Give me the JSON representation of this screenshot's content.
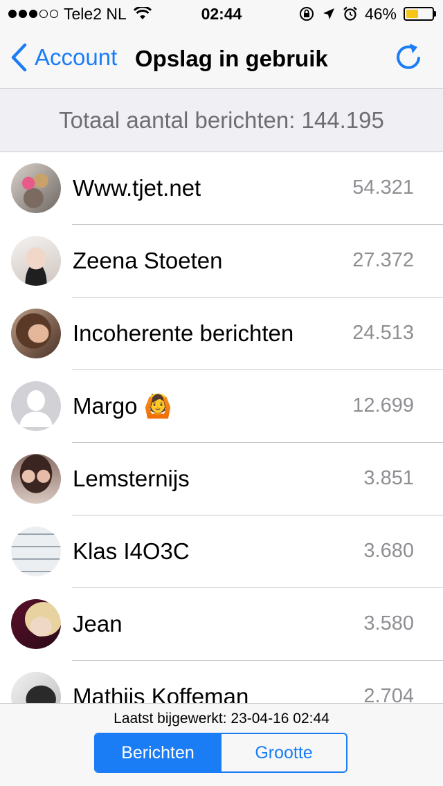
{
  "status_bar": {
    "carrier": "Tele2 NL",
    "time": "02:44",
    "battery": "46%",
    "battery_level": 0.46,
    "signal_bars_filled": 3,
    "signal_bars_total": 5
  },
  "nav": {
    "back_label": "Account",
    "title": "Opslag in gebruik",
    "refresh_icon": "refresh-icon"
  },
  "total": {
    "text": "Totaal aantal berichten: 144.195"
  },
  "rows": [
    {
      "name": "Www.tjet.net",
      "count": "54.321",
      "avatar": "photo"
    },
    {
      "name": "Zeena Stoeten",
      "count": "27.372",
      "avatar": "photo"
    },
    {
      "name": "Incoherente berichten",
      "count": "24.513",
      "avatar": "photo"
    },
    {
      "name": "Margo 🙆",
      "count": "12.699",
      "avatar": "default-person"
    },
    {
      "name": "Lemsternijs",
      "count": "3.851",
      "avatar": "photo"
    },
    {
      "name": "Klas I4O3C",
      "count": "3.680",
      "avatar": "photo"
    },
    {
      "name": "Jean",
      "count": "3.580",
      "avatar": "photo"
    },
    {
      "name": "Mathijs Koffeman",
      "count": "2.704",
      "avatar": "photo"
    }
  ],
  "footer": {
    "updated_text": "Laatst bijgewerkt: 23-04-16 02:44",
    "segments": [
      "Berichten",
      "Grootte"
    ],
    "selected_segment": "Berichten"
  },
  "colors": {
    "accent": "#1a7df5",
    "battery": "#f5c518",
    "count_gray": "#8e8e93"
  }
}
